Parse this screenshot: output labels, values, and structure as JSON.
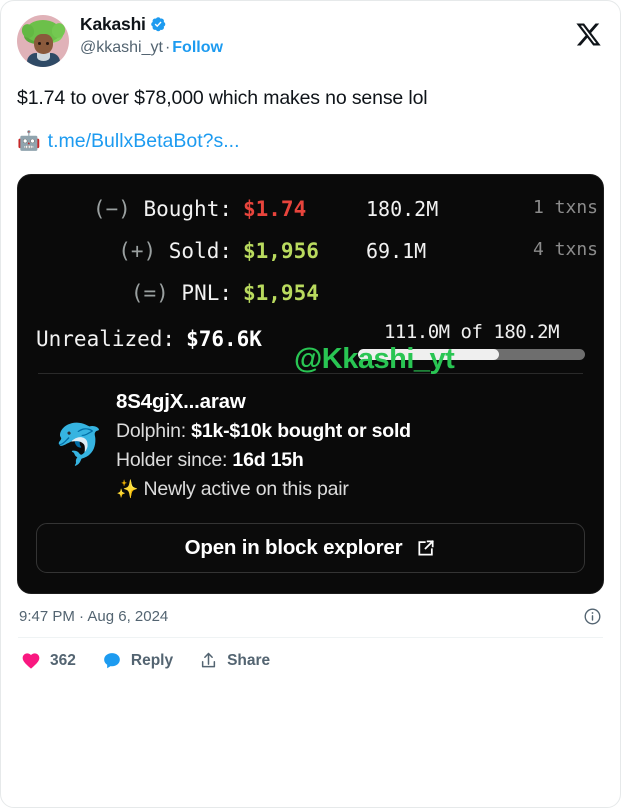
{
  "tweet": {
    "display_name": "Kakashi",
    "verified": true,
    "handle": "@kkashi_yt",
    "separator": "·",
    "follow_label": "Follow",
    "text": "$1.74 to over $78,000 which makes no sense lol",
    "link_emoji": "🤖",
    "link_text": "t.me/BullxBetaBot?s...",
    "timestamp": "9:47 PM · Aug 6, 2024",
    "brand_logo": "x-logo"
  },
  "preview": {
    "watermark": "@Kkashi_yt",
    "stats": [
      {
        "operator": "(−)",
        "label": "Bought:",
        "value": "$1.74",
        "value_color": "red",
        "amount": "180.2M",
        "txns": "1 txns"
      },
      {
        "operator": "(+)",
        "label": "Sold:",
        "value": "$1,956",
        "value_color": "green",
        "amount": "69.1M",
        "txns": "4 txns"
      },
      {
        "operator": "(=)",
        "label": "PNL:",
        "value": "$1,954",
        "value_color": "green",
        "amount": "",
        "txns": ""
      }
    ],
    "unrealized": {
      "label": "Unrealized:",
      "value": "$76.6K",
      "progress_caption": "111.0M of 180.2M",
      "progress_percent": 62
    },
    "holder": {
      "emoji": "🐬",
      "address": "8S4gjX...araw",
      "tier_label": "Dolphin:",
      "tier_value": "$1k-$10k bought or sold",
      "since_label": "Holder since:",
      "since_value": "16d 15h",
      "note_emoji": "✨",
      "note": "Newly active on this pair"
    },
    "explorer_button": "Open in block explorer",
    "colors": {
      "red": "#e8443c",
      "green": "#b9da5e",
      "watermark_green": "#29c553",
      "card_bg": "#0a0a0a"
    }
  },
  "actions": {
    "like_count": "362",
    "reply_label": "Reply",
    "share_label": "Share"
  }
}
